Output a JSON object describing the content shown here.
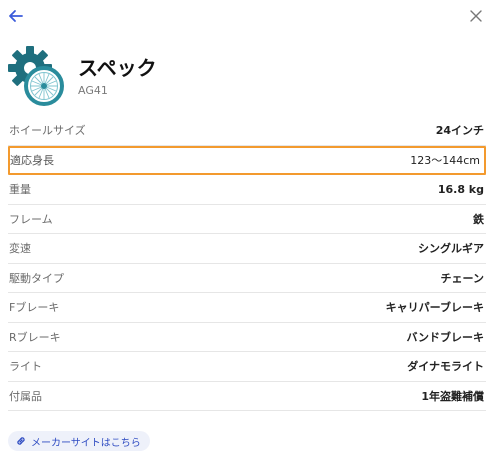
{
  "header": {
    "title": "スペック",
    "model": "AG41"
  },
  "specs": [
    {
      "label": "ホイールサイズ",
      "value": "24インチ"
    },
    {
      "label": "適応身長",
      "value": "123〜144cm"
    },
    {
      "label": "重量",
      "value": "16.8 kg"
    },
    {
      "label": "フレーム",
      "value": "鉄"
    },
    {
      "label": "変速",
      "value": "シングルギア"
    },
    {
      "label": "駆動タイプ",
      "value": "チェーン"
    },
    {
      "label": "Fブレーキ",
      "value": "キャリパーブレーキ"
    },
    {
      "label": "Rブレーキ",
      "value": "バンドブレーキ"
    },
    {
      "label": "ライト",
      "value": "ダイナモライト"
    },
    {
      "label": "付属品",
      "value": "1年盗難補償"
    }
  ],
  "link": {
    "label": "メーカーサイトはこちら"
  },
  "colors": {
    "accent": "#2f4cc2",
    "highlight": "#f39a2e",
    "logo_teal": "#1f7f8e"
  },
  "icons": [
    "back-arrow-icon",
    "close-icon",
    "gear-wheel-logo-icon",
    "link-icon"
  ]
}
